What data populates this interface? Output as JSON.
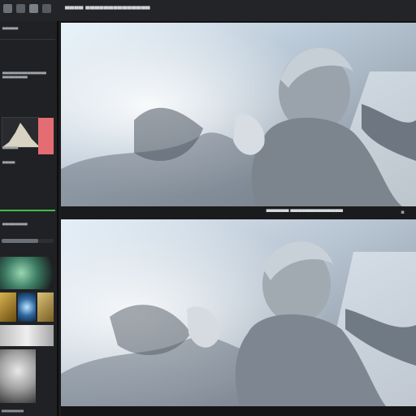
{
  "app": {
    "title_bar_text": "▀▀▀▀ ▀▀▀▀▀▀▀▀▀▀▀▀▀▀",
    "toolbar_icons": [
      "gear-icon",
      "folder-icon",
      "grid-icon",
      "image-icon",
      "tool-icon"
    ]
  },
  "sidebar": {
    "header_label": "▀▀▀▀▀",
    "section_label": "▄▄▄▄▄▄▄▄▄▄▄▄▄▄",
    "value_label": "▀▀▀▀▀▀▀▀",
    "field_label_1": "▄▄▄▄▄",
    "field_label_2": "▄▄▄▄",
    "bottom_label": "▄▄▄▄▄▄▄▄",
    "footer_label": "▄▄▄▄▄▄▄",
    "slider_value": 0.7,
    "swatch_color": "#e36d72",
    "green_color": "#3fbf48"
  },
  "viewer": {
    "midbar_label": "▀▀▀▀▀▀ ▀▀▀▀▀▀▀▀▀▀▀▀▀▀",
    "close_glyph": "▪"
  }
}
